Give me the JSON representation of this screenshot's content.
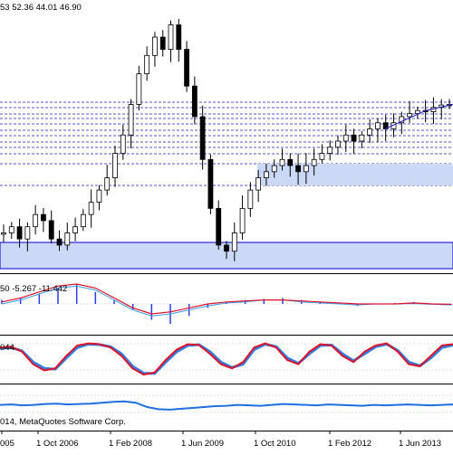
{
  "ohlc_readout": "53 52.36 44.01 46.90",
  "macd_readout": "50 -5.267 -11.442",
  "stoch_readout": "044",
  "copyright": "014, MetaQuotes Software Corp.",
  "date_labels": [
    "005",
    "1 Oct 2006",
    "1 Feb 2008",
    "1 Jun 2009",
    "1 Oct 2010",
    "1 Feb 2012",
    "1 Jun 2013"
  ],
  "colors": {
    "background": "#ffffff",
    "candle": "#000000",
    "fib_lines": "#1f1fbf",
    "zone_fill": "#cbd8f6",
    "zone_border": "#0000cc",
    "macd_hist": "#2b3fe0",
    "macd_signal": "#e0102a",
    "macd_line": "#3aa0e8",
    "stoch_main": "#e0102a",
    "stoch_signal": "#2f7fe0",
    "rsi_line": "#1f6fe0",
    "pane_divider": "#000000"
  },
  "chart_data": [
    {
      "type": "candlestick",
      "pane": "price",
      "series": [
        {
          "name": "price",
          "values": [
            26,
            27,
            25,
            27,
            29,
            28,
            25,
            24,
            26,
            27,
            29,
            31,
            33,
            35,
            39,
            42,
            47,
            52,
            55,
            58,
            56,
            60,
            56,
            50,
            45,
            38,
            30,
            24,
            23,
            26,
            30,
            33,
            35,
            36,
            37,
            38,
            37,
            36,
            37,
            38,
            39,
            40,
            41,
            42,
            41,
            42,
            43,
            44,
            43,
            44,
            45,
            45.5,
            46,
            45.8,
            46.5,
            46.9,
            47
          ]
        },
        {
          "name": "upper_trend",
          "values": [
            43,
            44,
            45,
            46,
            46.5,
            47
          ]
        }
      ]
    },
    {
      "type": "line",
      "pane": "macd",
      "series": [
        {
          "name": "macd_hist",
          "values": [
            0.2,
            0.3,
            0.5,
            0.8,
            1.0,
            0.6,
            0.2,
            -0.3,
            -0.8,
            -1.0,
            -0.6,
            -0.2,
            0.1,
            0.2,
            0.25,
            0.3,
            0.2,
            0.1,
            0.0,
            -0.1,
            0.0,
            0.05,
            0.1,
            0.0,
            -0.05
          ]
        },
        {
          "name": "macd_signal",
          "values": [
            0.1,
            0.3,
            0.6,
            0.9,
            1.0,
            0.8,
            0.3,
            -0.2,
            -0.5,
            -0.4,
            -0.2,
            0.0,
            0.1,
            0.15,
            0.2,
            0.2,
            0.15,
            0.1,
            0.05,
            0.0,
            0.0,
            0.0,
            0.05,
            0.0,
            -0.02
          ]
        },
        {
          "name": "macd_line",
          "values": [
            0.0,
            0.2,
            0.5,
            0.8,
            0.9,
            0.7,
            0.2,
            -0.3,
            -0.6,
            -0.5,
            -0.3,
            -0.1,
            0.05,
            0.1,
            0.2,
            0.2,
            0.1,
            0.05,
            0.0,
            -0.05,
            0.0,
            0.0,
            0.02,
            -0.02,
            -0.05
          ]
        }
      ]
    },
    {
      "type": "line",
      "pane": "stochastic",
      "series": [
        {
          "name": "stoch_main",
          "values": [
            80,
            82,
            70,
            40,
            25,
            30,
            60,
            85,
            90,
            88,
            80,
            60,
            30,
            15,
            20,
            50,
            75,
            88,
            86,
            65,
            40,
            30,
            45,
            80,
            90,
            80,
            50,
            40,
            70,
            88,
            85,
            60,
            45,
            70,
            85,
            90,
            70,
            40,
            35,
            60,
            85,
            88
          ]
        },
        {
          "name": "stoch_signal",
          "values": [
            78,
            80,
            72,
            45,
            30,
            28,
            55,
            80,
            88,
            87,
            82,
            65,
            35,
            18,
            18,
            45,
            70,
            85,
            87,
            70,
            45,
            32,
            40,
            75,
            88,
            82,
            55,
            42,
            65,
            85,
            86,
            65,
            48,
            65,
            82,
            88,
            73,
            45,
            36,
            55,
            80,
            86
          ]
        }
      ]
    },
    {
      "type": "line",
      "pane": "rsi",
      "series": [
        {
          "name": "rsi",
          "values": [
            55,
            56,
            54,
            55,
            57,
            58,
            56,
            57,
            58,
            60,
            62,
            63,
            60,
            50,
            45,
            44,
            46,
            48,
            50,
            52,
            53,
            55,
            54,
            53,
            55,
            57,
            56,
            55,
            54,
            56,
            55,
            54,
            53,
            55,
            54,
            55,
            56,
            55,
            54,
            55,
            56
          ]
        }
      ]
    }
  ]
}
